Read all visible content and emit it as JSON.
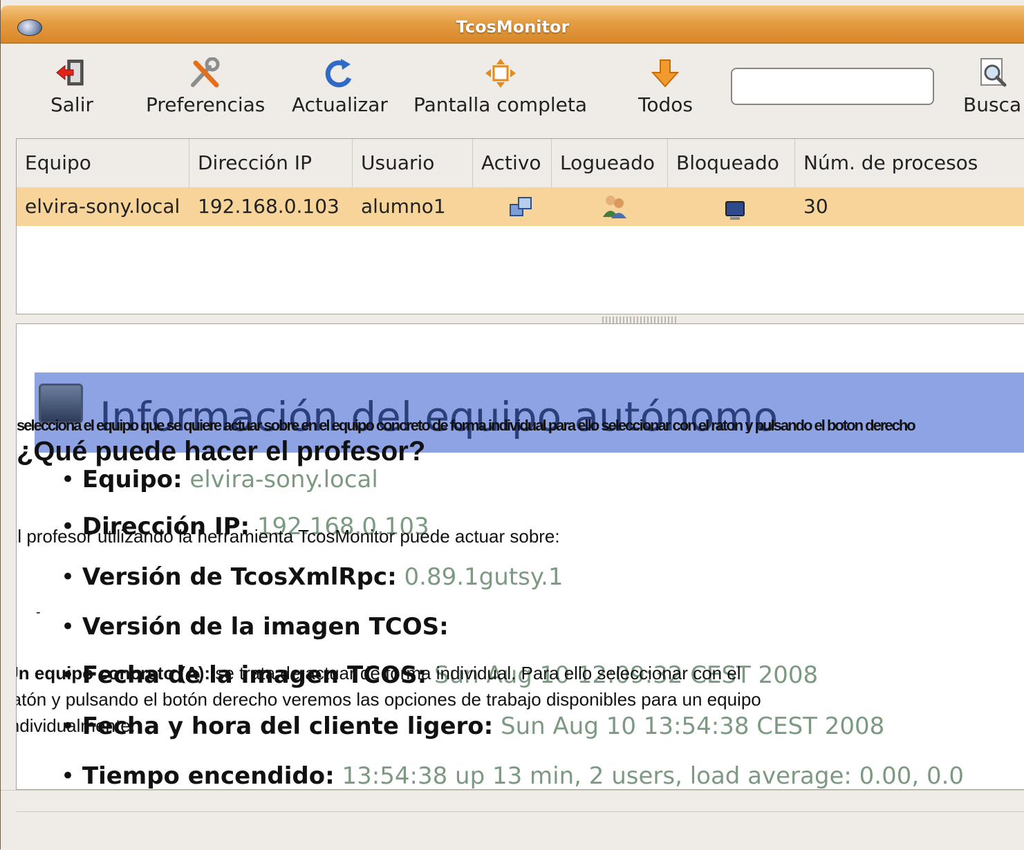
{
  "window": {
    "title": "TcosMonitor"
  },
  "toolbar": {
    "items": [
      {
        "label": "Salir",
        "icon": "exit-icon"
      },
      {
        "label": "Preferencias",
        "icon": "preferences-icon"
      },
      {
        "label": "Actualizar",
        "icon": "refresh-icon"
      },
      {
        "label": "Pantalla completa",
        "icon": "fullscreen-icon"
      },
      {
        "label": "Todos",
        "icon": "arrow-down-icon"
      },
      {
        "label": "Busca",
        "icon": "search-icon"
      }
    ],
    "search_value": ""
  },
  "table": {
    "columns": [
      "Equipo",
      "Dirección IP",
      "Usuario",
      "Activo",
      "Logueado",
      "Bloqueado",
      "Núm. de procesos"
    ],
    "rows": [
      {
        "equipo": "elvira-sony.local",
        "ip": "192.168.0.103",
        "usuario": "alumno1",
        "activo": "active-icon",
        "logueado": "users-icon",
        "bloqueado": "screen-icon",
        "procesos": "30"
      }
    ]
  },
  "info": {
    "title": "Información del equipo autónomo",
    "items": [
      {
        "label": "Equipo:",
        "value": "elvira-sony.local"
      },
      {
        "label": "Dirección IP:",
        "value": "192.168.0.103"
      },
      {
        "label": "Versión de TcosXmlRpc:",
        "value": "0.89.1gutsy.1"
      },
      {
        "label": "Versión de la imagen TCOS:",
        "value": ""
      },
      {
        "label": "Fecha de la imagen TCOS:",
        "value": "Sun Aug 10 12:09:32 CEST 2008"
      },
      {
        "label": "Fecha y hora del cliente ligero:",
        "value": "Sun Aug 10 13:54:38 CEST 2008"
      },
      {
        "label": "Tiempo encendido:",
        "value": "13:54:38 up 13 min, 2 users, load average: 0.00, 0.0"
      }
    ]
  },
  "overlay": {
    "garbled_line": "selecciona el equipo que se quiere actuar sobre en el equipo concreto de forma individual para ello seleccionar con el raton y pulsando el boton derecho",
    "question": "¿Qué puede hacer el profesor?",
    "intro": "El profesor utilizando la herramienta TcosMonitor puede actuar sobre:",
    "dash": "-",
    "para_bold": "Un equipo concreto (A):",
    "para_1": " se trata de actuar de forma individual. Para ello seleccionar con el",
    "para_2": "ratón y pulsando el botón derecho veremos las opciones de trabajo disponibles para un equipo",
    "para_3": "individualmente."
  }
}
